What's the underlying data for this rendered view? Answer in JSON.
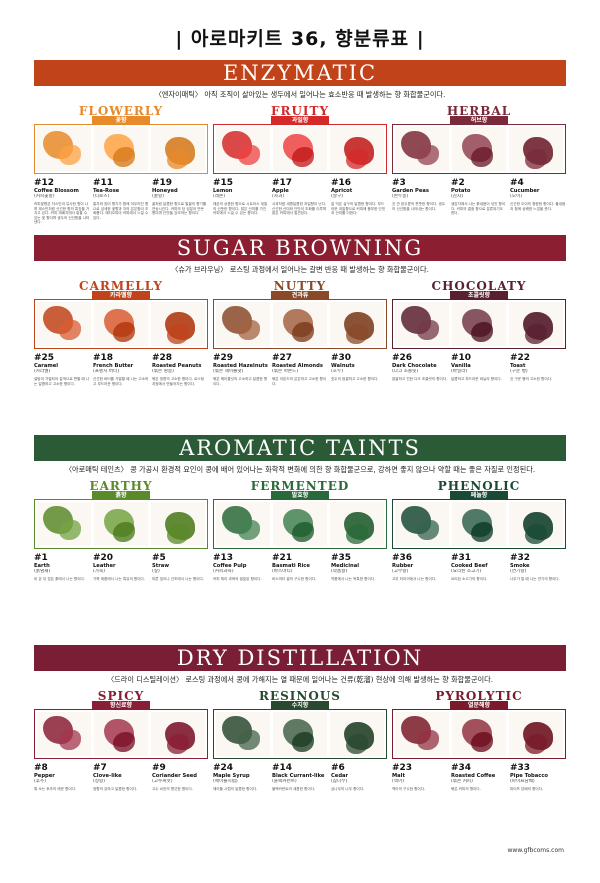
{
  "title": "| 아로마키트 36, 향분류표 |",
  "sections": [
    {
      "band": "ENZYMATIC",
      "band_color": "#c0431a",
      "subtitle": "〈엔자이매틱〉 아직 조직이 살아있는 생두에서 일어나는 효소반응 때 발생하는 향 화합물군이다.",
      "groups": [
        {
          "name": "FLOWERLY",
          "sub": "꽃향",
          "color": "#e8892a",
          "items": [
            {
              "num": "#12",
              "name": "Coffee Blossom",
              "kname": "(커피꽃향)",
              "desc": "커피꽃향은 자스민과 유사한 향이 나며 재스민처럼 신선한 향의 특징을 가지고 있다. 커피 재배지에서 맡을 수 있는 꽃 향이며 생두의 신선함을 나타낸다."
            },
            {
              "num": "#11",
              "name": "Tea-Rose",
              "kname": "(티로즈)",
              "desc": "홍차와 장미 향기가 함께 어우러진 향으로 섬세한 꽃향과 차의 은은함이 조화롭다. 에티오피아 커피에서 느낄 수 있다."
            },
            {
              "num": "#19",
              "name": "Honeyed",
              "kname": "(꿀향)",
              "desc": "꿀처럼 달콤한 향으로 벌꿀의 향기를 연상시킨다. 커피의 당 성분이 만든 향이며 단맛을 강조하는 향이다."
            }
          ]
        },
        {
          "name": "FRUITY",
          "sub": "과일향",
          "color": "#d42a2a",
          "items": [
            {
              "num": "#15",
              "name": "Lemon",
              "kname": "(레몬)",
              "desc": "레몬의 상큼한 향으로 시트러스 계열의 산뜻한 향이다. 밝은 산미를 가진 커피에서 느낄 수 있는 향이다."
            },
            {
              "num": "#17",
              "name": "Apple",
              "kname": "(사과)",
              "desc": "사과처럼 새콤달콤한 과일향이 난다. 신선한 산미와 단맛이 조화를 이루며 밝은 커피에서 발견된다."
            },
            {
              "num": "#16",
              "name": "Apricot",
              "kname": "(살구)",
              "desc": "잘 익은 살구의 달콤한 향이다. 부드러운 과일향으로 커피에 풍부한 단맛과 산미를 더한다."
            }
          ]
        },
        {
          "name": "HERBAL",
          "sub": "허브향",
          "color": "#7a2a3a",
          "items": [
            {
              "num": "#3",
              "name": "Garden Peas",
              "kname": "(완두콩)",
              "desc": "갓 깐 완두콩의 풋풋한 향이다. 생두의 신선함을 나타내는 향이다."
            },
            {
              "num": "#2",
              "name": "Potato",
              "kname": "(감자)",
              "desc": "생감자에서 나는 흙내음이 섞인 향이다. 커피의 결점 향으로 분류되기도 한다."
            },
            {
              "num": "#4",
              "name": "Cucumber",
              "kname": "(오이)",
              "desc": "신선한 오이의 청량한 향이다. 풀내음과 함께 상쾌한 느낌을 준다."
            }
          ]
        }
      ]
    },
    {
      "band": "SUGAR BROWNING",
      "band_color": "#8c1e32",
      "subtitle": "〈슈가 브라우닝〉 로스팅 과정에서 일어나는 갈변 반응 때 발생하는 향 화합물군이다.",
      "groups": [
        {
          "name": "CARMELLY",
          "sub": "카라멜향",
          "color": "#c0431a",
          "items": [
            {
              "num": "#25",
              "name": "Caramel",
              "kname": "(카라멜)",
              "desc": "설탕이 가열되어 갈색으로 변할 때 나는 달콤하고 고소한 향이다."
            },
            {
              "num": "#18",
              "name": "French Butter",
              "kname": "(프렌치 버터)",
              "desc": "신선한 버터를 가열할 때 나는 고소하고 부드러운 향이다."
            },
            {
              "num": "#28",
              "name": "Roasted Peanuts",
              "kname": "(볶은 땅콩)",
              "desc": "볶은 땅콩의 고소한 향이다. 로스팅 과정에서 만들어지는 향이다."
            }
          ]
        },
        {
          "name": "NUTTY",
          "sub": "견과류",
          "color": "#8a4a2a",
          "items": [
            {
              "num": "#29",
              "name": "Roasted Hazelnuts",
              "kname": "(볶은 헤이즐넛)",
              "desc": "볶은 헤이즐넛의 고소하고 달콤한 향이다."
            },
            {
              "num": "#27",
              "name": "Roasted Almonds",
              "kname": "(볶은 아몬드)",
              "desc": "볶은 아몬드의 은은하고 고소한 향이다."
            },
            {
              "num": "#30",
              "name": "Walnuts",
              "kname": "(호두)",
              "desc": "호두의 쌉쌀하고 고소한 향이다."
            }
          ]
        },
        {
          "name": "CHOCOLATY",
          "sub": "초콜릿향",
          "color": "#5a2030",
          "items": [
            {
              "num": "#26",
              "name": "Dark Chocolate",
              "kname": "(다크 초콜릿)",
              "desc": "쌉쌀하고 진한 다크 초콜릿의 향이다."
            },
            {
              "num": "#10",
              "name": "Vanilla",
              "kname": "(바닐라)",
              "desc": "달콤하고 부드러운 바닐라 향이다."
            },
            {
              "num": "#22",
              "name": "Toast",
              "kname": "(구운 빵)",
              "desc": "갓 구운 빵의 고소한 향이다."
            }
          ]
        }
      ]
    },
    {
      "band": "AROMATIC TAINTS",
      "band_color": "#2a5a36",
      "subtitle": "〈아로매틱 테인츠〉 콩 가공시 환경적 요인이 콩에 배어 있어나는 화학적 변화에 의한 향 화합물군으로, 강하면 좋지 않으나 약할 때는 좋은 자질로 인정된다.",
      "groups": [
        {
          "name": "EARTHY",
          "sub": "흙향",
          "color": "#5a8a2a",
          "items": [
            {
              "num": "#1",
              "name": "Earth",
              "kname": "(흙냄새)",
              "desc": "비 온 뒤 젖은 흙에서 나는 향이다."
            },
            {
              "num": "#20",
              "name": "Leather",
              "kname": "(가죽)",
              "desc": "가죽 제품에서 나는 특유의 향이다."
            },
            {
              "num": "#5",
              "name": "Straw",
              "kname": "(짚)",
              "desc": "마른 짚이나 건초에서 나는 향이다."
            }
          ]
        },
        {
          "name": "FERMENTED",
          "sub": "발효향",
          "color": "#2a6a3a",
          "items": [
            {
              "num": "#13",
              "name": "Coffee Pulp",
              "kname": "(커피과육)",
              "desc": "커피 체리 과육의 발효된 향이다."
            },
            {
              "num": "#21",
              "name": "Basmati Rice",
              "kname": "(바스마티)",
              "desc": "바스마티 쌀의 구수한 향이다."
            },
            {
              "num": "#35",
              "name": "Medicinal",
              "kname": "(약품향)",
              "desc": "약품에서 나는 독특한 향이다."
            }
          ]
        },
        {
          "name": "PHENOLIC",
          "sub": "페놀향",
          "color": "#1a4a36",
          "items": [
            {
              "num": "#36",
              "name": "Rubber",
              "kname": "(고무향)",
              "desc": "고무 타이어에서 나는 향이다."
            },
            {
              "num": "#31",
              "name": "Cooked Beef",
              "kname": "(요리된 소고기)",
              "desc": "요리된 소고기의 향이다."
            },
            {
              "num": "#32",
              "name": "Smoke",
              "kname": "(연기향)",
              "desc": "나무가 탈 때 나는 연기의 향이다."
            }
          ]
        }
      ]
    },
    {
      "band": "DRY DISTILLATION",
      "band_color": "#7a1e36",
      "subtitle": "〈드라이 디스틸레이션〉 로스팅 과정에서 콩에 가해지는 열 때문에 일어나는 건류(乾溜) 현상에 의해 발생하는 향 화합물군이다.",
      "groups": [
        {
          "name": "SPICY",
          "sub": "향신료향",
          "color": "#8a1e36",
          "items": [
            {
              "num": "#8",
              "name": "Pepper",
              "kname": "(후추)",
              "desc": "톡 쏘는 후추의 매운 향이다."
            },
            {
              "num": "#7",
              "name": "Clove-like",
              "kname": "(정향)",
              "desc": "정향의 강하고 달콤한 향이다."
            },
            {
              "num": "#9",
              "name": "Coriander Seed",
              "kname": "(고수씨앗)",
              "desc": "고수 씨앗의 향긋한 향이다."
            }
          ]
        },
        {
          "name": "RESINOUS",
          "sub": "수지향",
          "color": "#2a4a30",
          "items": [
            {
              "num": "#24",
              "name": "Maple Syrup",
              "kname": "(메이플시럽)",
              "desc": "메이플 시럽의 달콤한 향이다."
            },
            {
              "num": "#14",
              "name": "Black Currant-like",
              "kname": "(블랙커런트)",
              "desc": "블랙커런트의 새콤한 향이다."
            },
            {
              "num": "#6",
              "name": "Cedar",
              "kname": "(삼나무)",
              "desc": "삼나무의 나무 향이다."
            }
          ]
        },
        {
          "name": "PYROLYTIC",
          "sub": "열분해향",
          "color": "#7a1a2a",
          "items": [
            {
              "num": "#23",
              "name": "Malt",
              "kname": "(맥아)",
              "desc": "맥아의 구수한 향이다."
            },
            {
              "num": "#34",
              "name": "Roasted Coffee",
              "kname": "(볶은 커피)",
              "desc": "볶은 커피의 향이다."
            },
            {
              "num": "#33",
              "name": "Pipe Tobacco",
              "kname": "(파이프담배)",
              "desc": "파이프 담배의 향이다."
            }
          ]
        }
      ]
    }
  ],
  "footer": "www.gfbcoms.com"
}
